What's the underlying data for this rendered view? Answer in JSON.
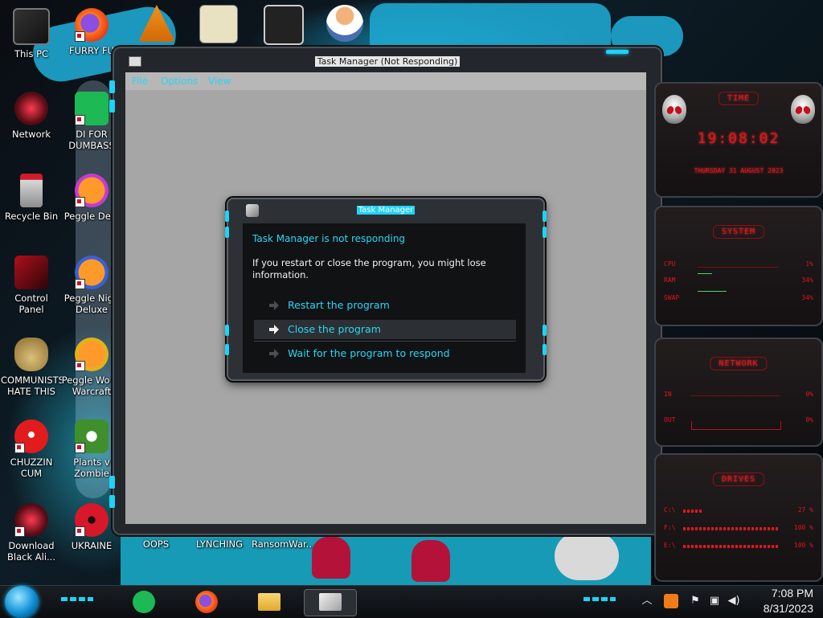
{
  "desktop": {
    "icons": [
      {
        "label": "This PC"
      },
      {
        "label": "FURRY FU"
      },
      {
        "label": "Network"
      },
      {
        "label": "DI FOR DUMBASS"
      },
      {
        "label": "Recycle Bin"
      },
      {
        "label": "Peggle Delu"
      },
      {
        "label": "Control Panel"
      },
      {
        "label": "Peggle Nigh Deluxe"
      },
      {
        "label": "COMMUNISTS HATE THIS G..."
      },
      {
        "label": "Peggle Wo of Warcraft"
      },
      {
        "label": "CHUZZIN CUM"
      },
      {
        "label": "Plants v Zombie"
      },
      {
        "label": "Download Black Ali..."
      },
      {
        "label": "UKRAINE"
      },
      {
        "label": "OOPS"
      },
      {
        "label": "LYNCHING"
      },
      {
        "label": "RansomWar..."
      }
    ]
  },
  "window": {
    "title": "Task Manager (Not Responding)",
    "menu": [
      "File",
      "Options",
      "View"
    ]
  },
  "dialog": {
    "title": "Task Manager",
    "heading": "Task Manager is not responding",
    "message": "If you restart or close the program, you might lose information.",
    "options": [
      {
        "label": "Restart the program",
        "selected": false
      },
      {
        "label": "Close the program",
        "selected": true
      },
      {
        "label": "Wait for the program to respond",
        "selected": false
      }
    ]
  },
  "widgets": {
    "time": {
      "title": "TIME",
      "clock": "19:08:02",
      "date": "THURSDAY 31 AUGUST 2023"
    },
    "system": {
      "title": "SYSTEM",
      "rows": [
        {
          "key": "CPU",
          "value": "1%"
        },
        {
          "key": "RAM",
          "value": "34%"
        },
        {
          "key": "SWAP",
          "value": "34%"
        }
      ]
    },
    "network": {
      "title": "NETWORK",
      "rows": [
        {
          "key": "IN",
          "value": "0%"
        },
        {
          "key": "OUT",
          "value": "0%"
        }
      ]
    },
    "drives": {
      "title": "DRIVES",
      "rows": [
        {
          "key": "C:\\",
          "value": "27 %"
        },
        {
          "key": "F:\\",
          "value": "100 %"
        },
        {
          "key": "E:\\",
          "value": "100 %"
        }
      ]
    },
    "accent": "#e0161c"
  },
  "taskbar": {
    "time": "7:08 PM",
    "date": "8/31/2023",
    "apps": [
      "spotify-icon",
      "firefox-icon",
      "file-explorer-icon",
      "task-manager-icon"
    ],
    "tray": [
      "chevron-up-icon",
      "fire-icon",
      "flag-icon",
      "network-icon",
      "volume-icon"
    ]
  },
  "colors": {
    "accent_cyan": "#1ed3f5",
    "menu_text": "#26d6f5"
  }
}
